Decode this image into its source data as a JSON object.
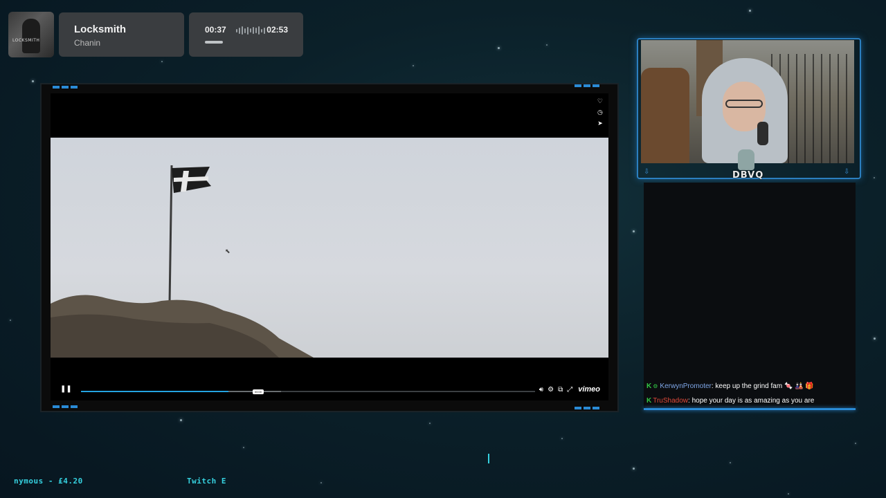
{
  "now_playing": {
    "album_art_label": "LOCKSMITH",
    "track_title": "Locksmith",
    "artist": "Chanin",
    "elapsed": "00:37",
    "duration": "02:53",
    "progress_fraction": 0.21
  },
  "video_player": {
    "side_icons": [
      "heart-icon",
      "clock-icon",
      "share-icon"
    ],
    "progress_fraction": 0.325,
    "buffer_fraction": 0.44,
    "tooltip": "00:00",
    "brand": "vimeo",
    "accent_color": "#24a3e0"
  },
  "webcam": {
    "logo_text": "DBVQ"
  },
  "chat": {
    "messages": [
      {
        "user": "KerwynPromoter",
        "user_color": "#7fa7e8",
        "text": ": keep up the grind fam 🍬 🎎 🎁"
      },
      {
        "user": "TruShadow",
        "user_color": "#e04a3a",
        "text": ": hope your day is as amazing as you are"
      }
    ]
  },
  "tickers": {
    "left": "nymous - £4.20",
    "middle": "Twitch E"
  }
}
